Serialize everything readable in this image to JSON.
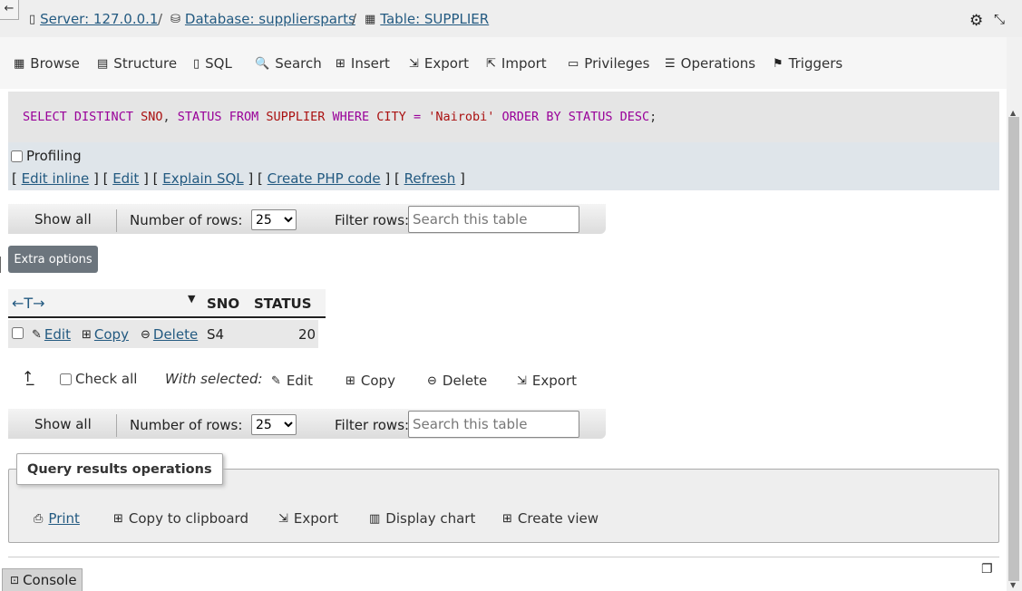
{
  "breadcrumb": {
    "server": "Server: 127.0.0.1",
    "database": "Database: suppliersparts",
    "table": "Table: SUPPLIER",
    "separator": "/"
  },
  "tabs": [
    "Browse",
    "Structure",
    "SQL",
    "Search",
    "Insert",
    "Export",
    "Import",
    "Privileges",
    "Operations",
    "Triggers"
  ],
  "sql": {
    "select": "SELECT",
    "distinct": "DISTINCT",
    "sno": "SNO",
    "comma": ",",
    "status": "STATUS",
    "from": "FROM",
    "table": "SUPPLIER",
    "where": "WHERE",
    "city": "CITY",
    "eq": "=",
    "value": "'Nairobi'",
    "order": "ORDER",
    "by": "BY",
    "status2": "STATUS",
    "desc": "DESC",
    "semicolon": ";"
  },
  "profiling_label": "Profiling",
  "sql_links": {
    "edit_inline": "Edit inline",
    "edit": "Edit",
    "explain": "Explain SQL",
    "php": "Create PHP code",
    "refresh": "Refresh"
  },
  "navbar": {
    "show_all": "Show all",
    "rows_label": "Number of rows:",
    "rows_value": "25",
    "filter_label": "Filter rows:",
    "filter_placeholder": "Search this table"
  },
  "extra_options": "Extra options",
  "table": {
    "arrows": "←T→",
    "sort_indicator": "▼",
    "columns": [
      "SNO",
      "STATUS"
    ],
    "rows": [
      {
        "edit": "Edit",
        "copy": "Copy",
        "delete": "Delete",
        "sno": "S4",
        "status": "20"
      }
    ]
  },
  "with_selected": {
    "check_all": "Check all",
    "label": "With selected:",
    "edit": "Edit",
    "copy": "Copy",
    "delete": "Delete",
    "export": "Export"
  },
  "query_results_ops": {
    "title": "Query results operations",
    "print": "Print",
    "copy_clipboard": "Copy to clipboard",
    "export": "Export",
    "display_chart": "Display chart",
    "create_view": "Create view"
  },
  "console": "Console"
}
